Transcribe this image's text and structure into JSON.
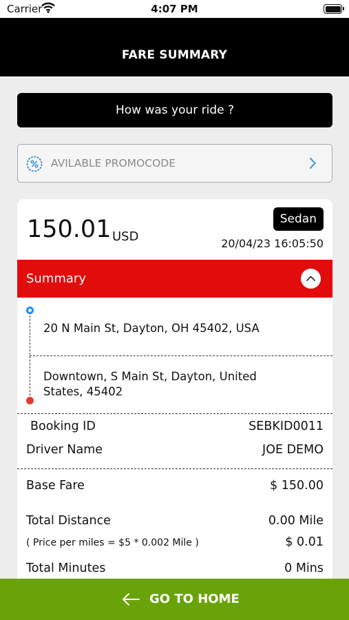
{
  "status_bar": {
    "carrier": "Carrier",
    "time": "4:07 PM"
  },
  "header": {
    "title": "FARE SUMMARY"
  },
  "feedback": {
    "label": "How was your ride ?"
  },
  "promo": {
    "label": "AVILABLE PROMOCODE"
  },
  "fare": {
    "amount": "150.01",
    "currency": "USD",
    "vehicle_type": "Sedan",
    "datetime": "20/04/23 16:05:50"
  },
  "summary": {
    "label": "Summary"
  },
  "route": {
    "pickup": "20 N Main St, Dayton, OH 45402, USA",
    "dropoff": "Downtown, S Main St, Dayton, United States, 45402"
  },
  "booking": {
    "booking_id_label": "Booking ID",
    "booking_id": "SEBKID0011",
    "driver_label": "Driver Name",
    "driver": "JOE DEMO"
  },
  "charges": {
    "base_fare_label": "Base Fare",
    "base_fare": "$ 150.00",
    "distance_label": "Total Distance",
    "distance": "0.00 Mile",
    "price_note": "( Price per miles = $5 * 0.002 Mile )",
    "price_value": "$ 0.01",
    "minutes_label": "Total Minutes",
    "minutes": "0 Mins"
  },
  "footer": {
    "label": "GO TO HOME"
  },
  "colors": {
    "summary_red": "#e20c0c",
    "home_green": "#6aa309",
    "pickup_blue": "#1a8cff",
    "drop_red": "#e53935"
  }
}
